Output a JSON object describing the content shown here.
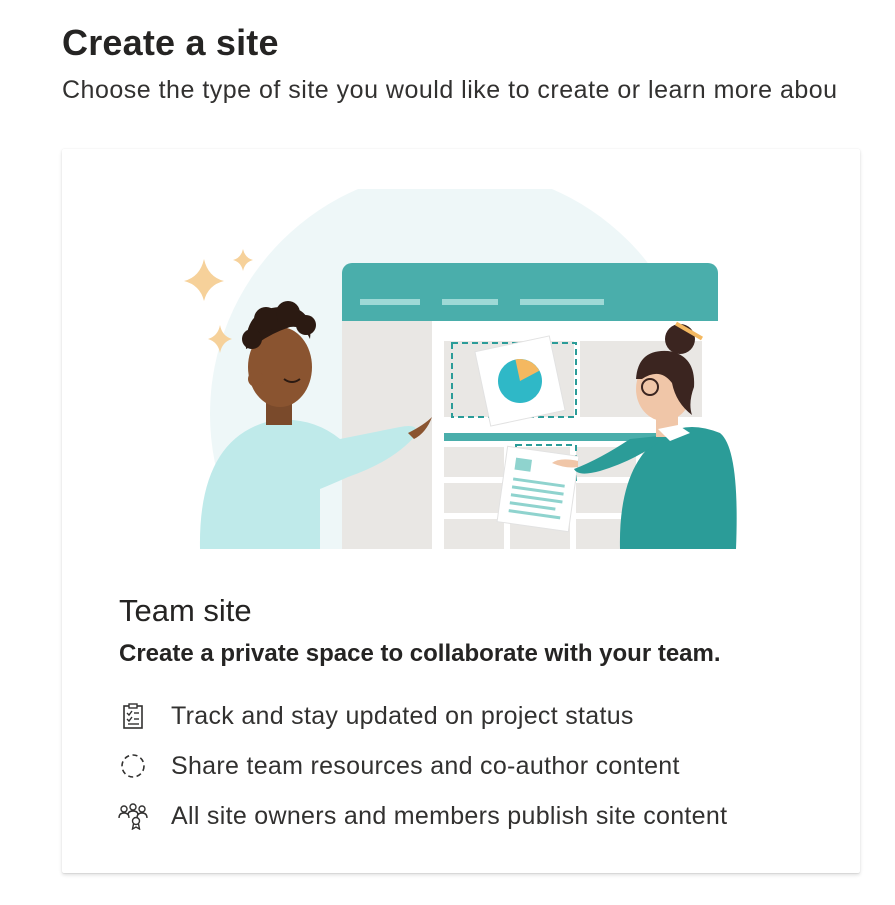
{
  "header": {
    "title": "Create a site",
    "subtitle": "Choose the type of site you would like to create or learn more abou"
  },
  "card": {
    "title": "Team site",
    "description": "Create a private space to collaborate with your team.",
    "features": [
      {
        "icon": "clipboard-checklist-icon",
        "text": "Track and stay updated on project status"
      },
      {
        "icon": "dashed-circle-icon",
        "text": "Share team resources and co-author content"
      },
      {
        "icon": "people-group-icon",
        "text": "All site owners and members publish site content"
      }
    ]
  },
  "colors": {
    "teal": "#4fb2ae",
    "teal_dark": "#2b9c98",
    "light_teal": "#bfeaea",
    "gold": "#f4b860",
    "text": "#323130"
  }
}
